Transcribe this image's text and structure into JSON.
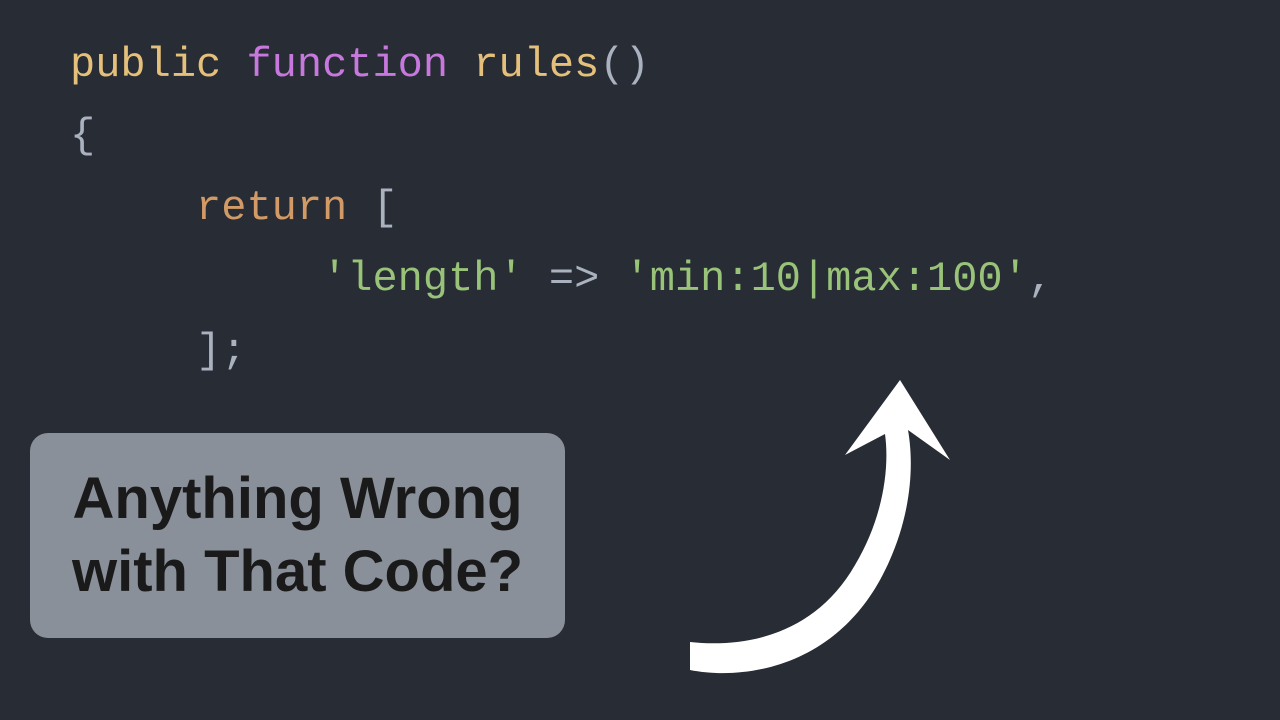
{
  "code": {
    "line1": {
      "public": "public",
      "function": "function",
      "name": "rules",
      "parens": "()"
    },
    "line2": {
      "brace": "{"
    },
    "line3": {
      "return": "return",
      "bracket": "["
    },
    "line4": {
      "key": "'length'",
      "arrow": "=>",
      "value": "'min:10|max:100'",
      "comma": ","
    },
    "line5": {
      "bracket": "]",
      "semicolon": ";"
    }
  },
  "callout": {
    "line1": "Anything Wrong",
    "line2": "with That Code?"
  }
}
